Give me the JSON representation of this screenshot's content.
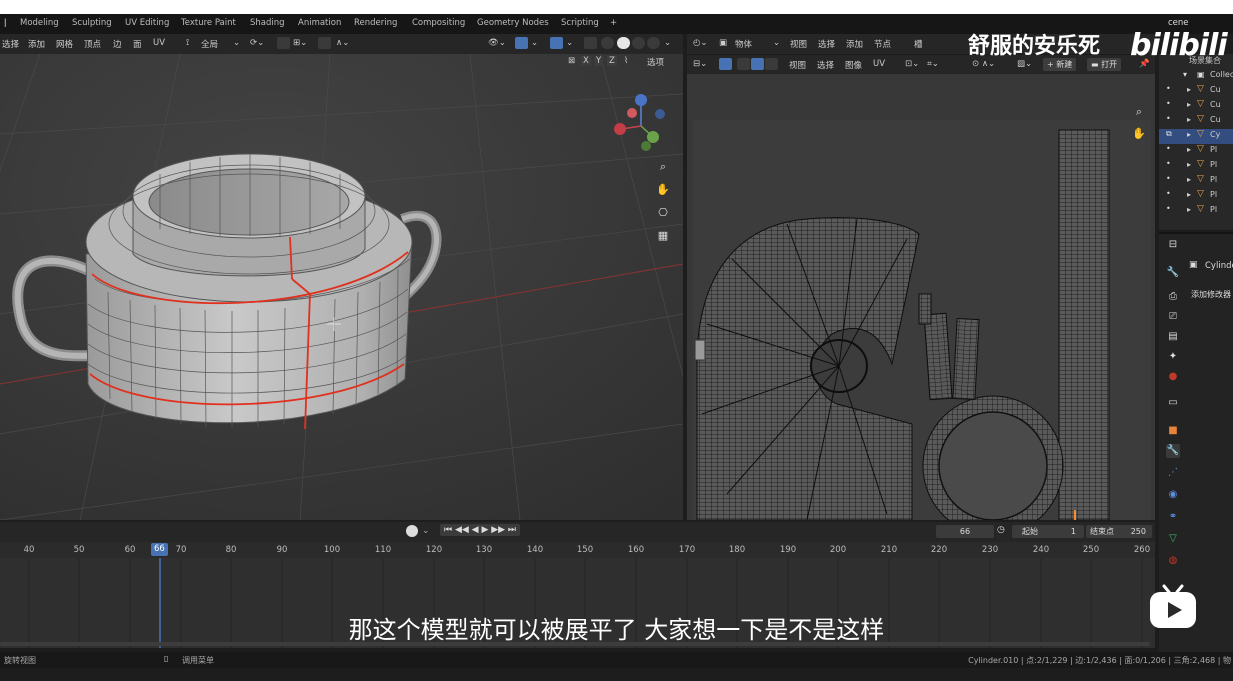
{
  "workspace_tabs": [
    "Modeling",
    "Sculpting",
    "UV Editing",
    "Texture Paint",
    "Shading",
    "Animation",
    "Rendering",
    "Compositing",
    "Geometry Nodes",
    "Scripting",
    "+"
  ],
  "scene_label": "cene",
  "viewport": {
    "menu": [
      "选择",
      "添加",
      "网格",
      "顶点",
      "边",
      "面",
      "UV"
    ],
    "transform_orientation": "全局",
    "axis_buttons": [
      "X",
      "Y",
      "Z"
    ],
    "options_label": "选项"
  },
  "uv_editor": {
    "top_mode_value": "物体",
    "top_menu": [
      "视图",
      "选择",
      "添加",
      "节点"
    ],
    "top_dropdown_value": "槽",
    "menu": [
      "视图",
      "选择",
      "图像",
      "UV"
    ],
    "new_label": "新建",
    "open_label": "打开"
  },
  "outliner": {
    "header": "场景集合",
    "collection": "Collec",
    "items": [
      "Cu",
      "Cu",
      "Cu",
      "Cy",
      "Pl",
      "Pl",
      "Pl",
      "Pl",
      "Pl"
    ],
    "selected_index": 3
  },
  "properties": {
    "object_name": "Cylinde",
    "add_modifier": "添加修改器"
  },
  "timeline": {
    "current_frame": "66",
    "start_label": "起始",
    "start_value": "1",
    "end_label": "结束点",
    "end_value": "250",
    "ruler_ticks": [
      "40",
      "50",
      "60",
      "70",
      "80",
      "90",
      "100",
      "110",
      "120",
      "130",
      "140",
      "150",
      "160",
      "170",
      "180",
      "190",
      "200",
      "210",
      "220",
      "230",
      "240",
      "250",
      "260"
    ]
  },
  "statusbar": {
    "left": "旋转视图",
    "middle": "调用菜单",
    "right": "Cylinder.010 | 点:2/1,229 | 边:1/2,436 | 面:0/1,206 | 三角:2,468 | 物"
  },
  "overlays": {
    "subtitle": "那这个模型就可以被展平了 大家想一下是不是这样",
    "watermark": "舒服的安乐死",
    "logo": "bilibili"
  },
  "colors": {
    "accent": "#4772b3",
    "seam": "#e0301e",
    "background": "#1d1d1d",
    "viewport_bg": "#3a3a3a"
  }
}
